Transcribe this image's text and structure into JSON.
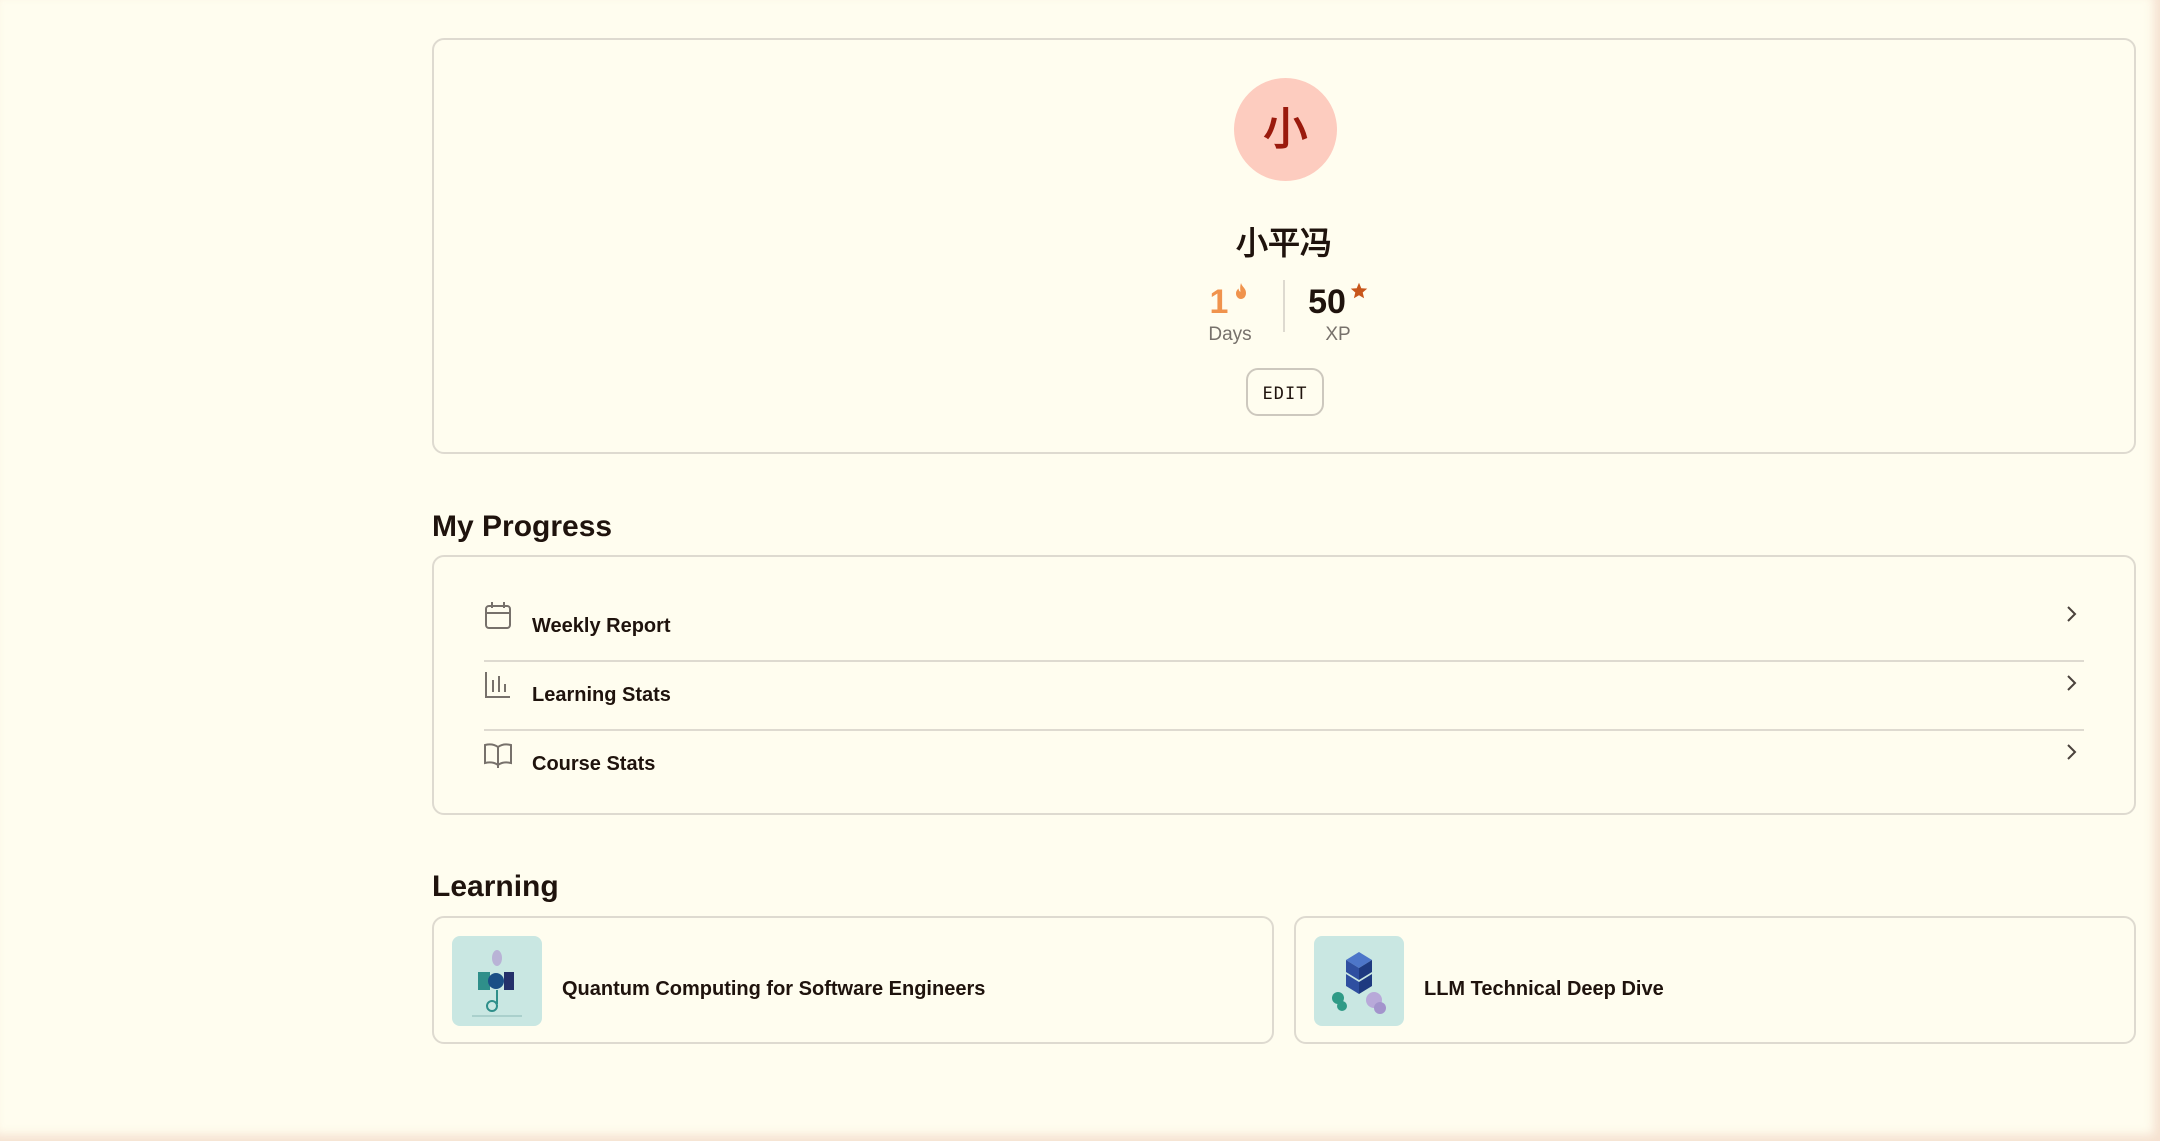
{
  "profile": {
    "avatar_initial": "小",
    "username": "小平冯",
    "streak": {
      "value": "1",
      "label": "Days"
    },
    "xp": {
      "value": "50",
      "label": "XP"
    },
    "edit_label": "EDIT"
  },
  "progress": {
    "title": "My Progress",
    "items": [
      {
        "label": "Weekly Report",
        "icon": "calendar-icon"
      },
      {
        "label": "Learning Stats",
        "icon": "bar-chart-icon"
      },
      {
        "label": "Course Stats",
        "icon": "open-book-icon"
      }
    ]
  },
  "learning": {
    "title": "Learning",
    "courses": [
      {
        "title": "Quantum Computing for Software Engineers"
      },
      {
        "title": "LLM Technical Deep Dive"
      }
    ]
  },
  "colors": {
    "background": "#fffdef",
    "avatar_bg": "#fdccbf",
    "avatar_text": "#9a1a0d",
    "streak": "#f0934d",
    "xp_star": "#c8561b",
    "border": "#dedad0",
    "thumb_bg": "#c9e7e2"
  }
}
